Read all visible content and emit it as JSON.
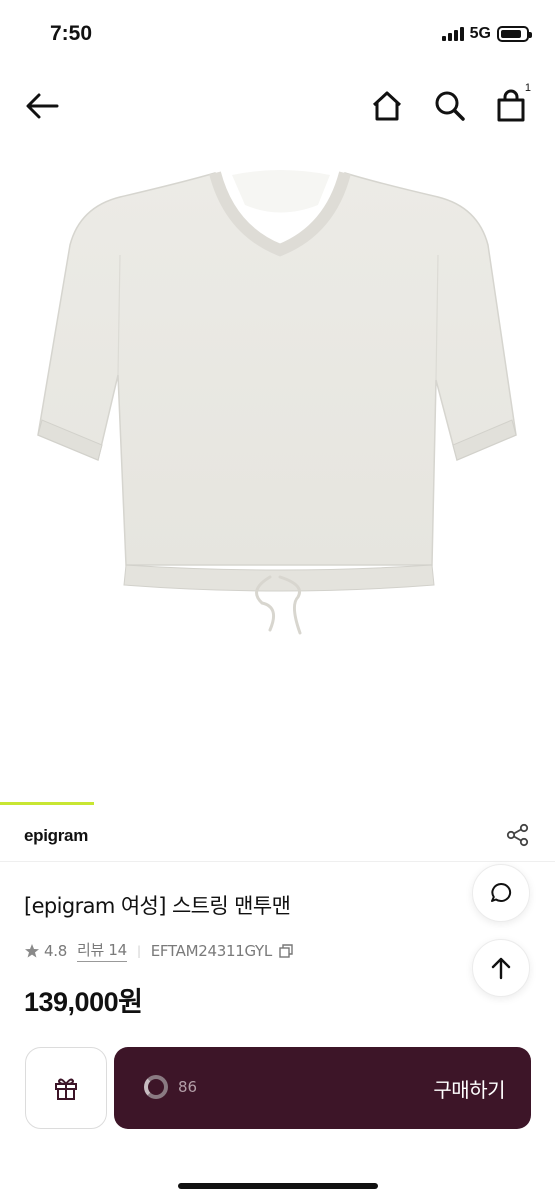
{
  "status_bar": {
    "time": "7:50",
    "network": "5G",
    "battery_level": 0.85
  },
  "nav": {
    "back_icon": "arrow-left-icon",
    "home_icon": "home-icon",
    "search_icon": "search-icon",
    "cart_icon": "shopping-bag-icon",
    "cart_count": "1"
  },
  "product": {
    "image_progress": 0.17,
    "brand": "epigram",
    "title": "[epigram 여성] 스트링 맨투맨",
    "rating": "4.8",
    "review_label": "리뷰 14",
    "product_code": "EFTAM24311GYL",
    "price": "139,000원"
  },
  "floating": {
    "chat_icon": "chat-bubble-icon",
    "top_icon": "arrow-up-icon"
  },
  "bottom_bar": {
    "gift_icon": "gift-icon",
    "like_count": "86",
    "buy_label": "구매하기"
  },
  "colors": {
    "accent": "#c8e632",
    "buy_button": "#3d1528"
  }
}
